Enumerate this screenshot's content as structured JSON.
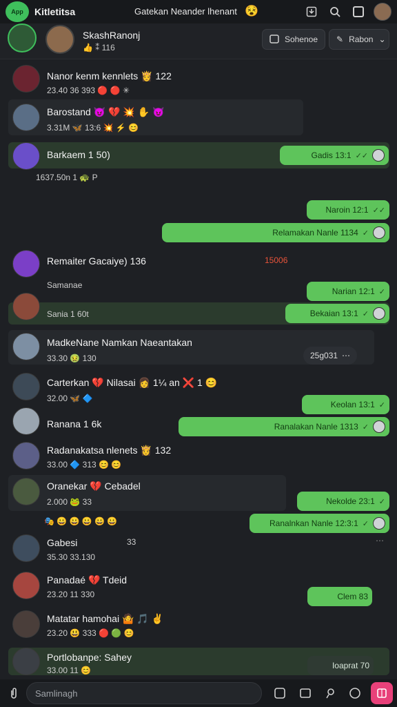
{
  "topbar": {
    "app_logo": "App",
    "app_name": "Kitletitsa",
    "window_title": "Gatekan Neander lhenant",
    "title_emoji": "😵",
    "icons": [
      "download-icon",
      "search-icon",
      "panel-icon",
      "avatar"
    ]
  },
  "header": {
    "name": "SkashRanonj",
    "meta": "👍 ⁑ 116",
    "button_1": "Sohenoe",
    "button_2": "Rabon"
  },
  "messages": [
    {
      "title": "Nanor kenm kennlets 👸 122",
      "sub": "23.40 36 393 🔴 🔴 ✳"
    },
    {
      "title": "Barostand 😈 💔 💥 ✋ 😈",
      "sub": "3.31M 🦋 13:6 💥 ⚡ 😊"
    },
    {
      "title": "Barkaem 1 50)",
      "sub": "1637.50n 1 🐢 P",
      "sent": "Gadis 13:1"
    },
    {
      "sent": "Naroin 12:1"
    },
    {
      "sent": "Relamakan Nanle 1134"
    },
    {
      "title": "Remaiter Gacaiye) 136",
      "badge": "15006",
      "sub": "Samanae",
      "sent": "Narian 12:1"
    },
    {
      "sub": "Sania 1 60t",
      "sent": "Bekaian 13:1"
    },
    {
      "title": "MadkeNane Namkan Naeantakan",
      "sub": "33.30 🤢 130",
      "pill": "25g031"
    },
    {
      "title": "Carterkan 💔 Nilasai 👩 1¼ an ❌ 1 😊",
      "sub": "32.00 🦋 🔷",
      "sent": "Keolan 13:1"
    },
    {
      "title": "Ranana 1 6k",
      "sent": "Ranalakan Nanle 1313"
    },
    {
      "title": "Radanakatsa nlenets 👸 132",
      "sub": "33.00 🔷 313 😊 😊"
    },
    {
      "title": "Oranekar 💔 Cebadel",
      "sub": "2.000 🐸 33",
      "sent": "Nekolde 23:1"
    },
    {
      "sub": "🎭 😀 😀 😀 😀 😀",
      "sent": "Ranalnkan Nanle 12:3:1"
    },
    {
      "title": "Gabesi",
      "meta": "33",
      "sub": "35.30 33.130"
    },
    {
      "title": "Panadaé 💔 Tdeid",
      "sub": "23.20 11 330",
      "sent": "Clem 83"
    },
    {
      "title": "Matatar hamohai 🤷 🎵 ✌",
      "sub": "23.20 😃 333 🔴 🟢 😊"
    },
    {
      "title": "Portlobanpe: Sahey",
      "sub": "33.00 11 😊",
      "sent": "Ioaprat 70"
    }
  ],
  "composer": {
    "placeholder": "Samlinagh",
    "icons": [
      "attach-icon",
      "sticker-icon",
      "gif-icon",
      "location-icon",
      "emoji-icon",
      "send-button"
    ]
  },
  "colors": {
    "accent": "#5ec45b",
    "background": "#1e2024",
    "send": "#e8417a",
    "badge_red": "#e8533a"
  }
}
